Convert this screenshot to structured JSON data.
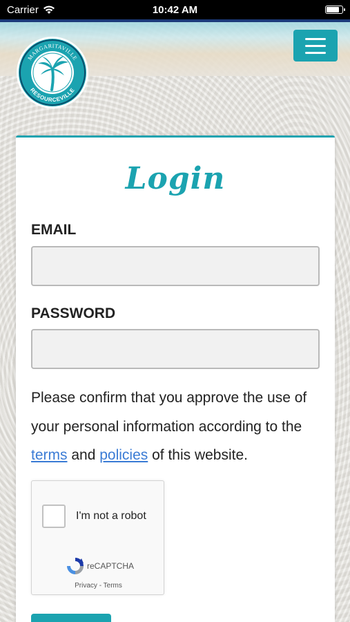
{
  "status_bar": {
    "carrier": "Carrier",
    "time": "10:42 AM",
    "battery_level": 0.9
  },
  "header": {
    "logo_top_text": "MARGARITAVILLE",
    "logo_bottom_text": "RESOURCEVILLE",
    "menu_icon": "hamburger-icon"
  },
  "login": {
    "title": "Login",
    "email_label": "EMAIL",
    "email_value": "",
    "password_label": "PASSWORD",
    "password_value": "",
    "consent_before": "Please confirm that you approve the use of your personal information according to the ",
    "terms_link": "terms",
    "consent_and": " and ",
    "policies_link": "policies",
    "consent_after": " of this website."
  },
  "recaptcha": {
    "label": "I'm not a robot",
    "brand": "reCAPTCHA",
    "links": "Privacy - Terms"
  },
  "colors": {
    "accent": "#1ba3b0",
    "link": "#3a7bd5",
    "status_bar": "#000000"
  }
}
